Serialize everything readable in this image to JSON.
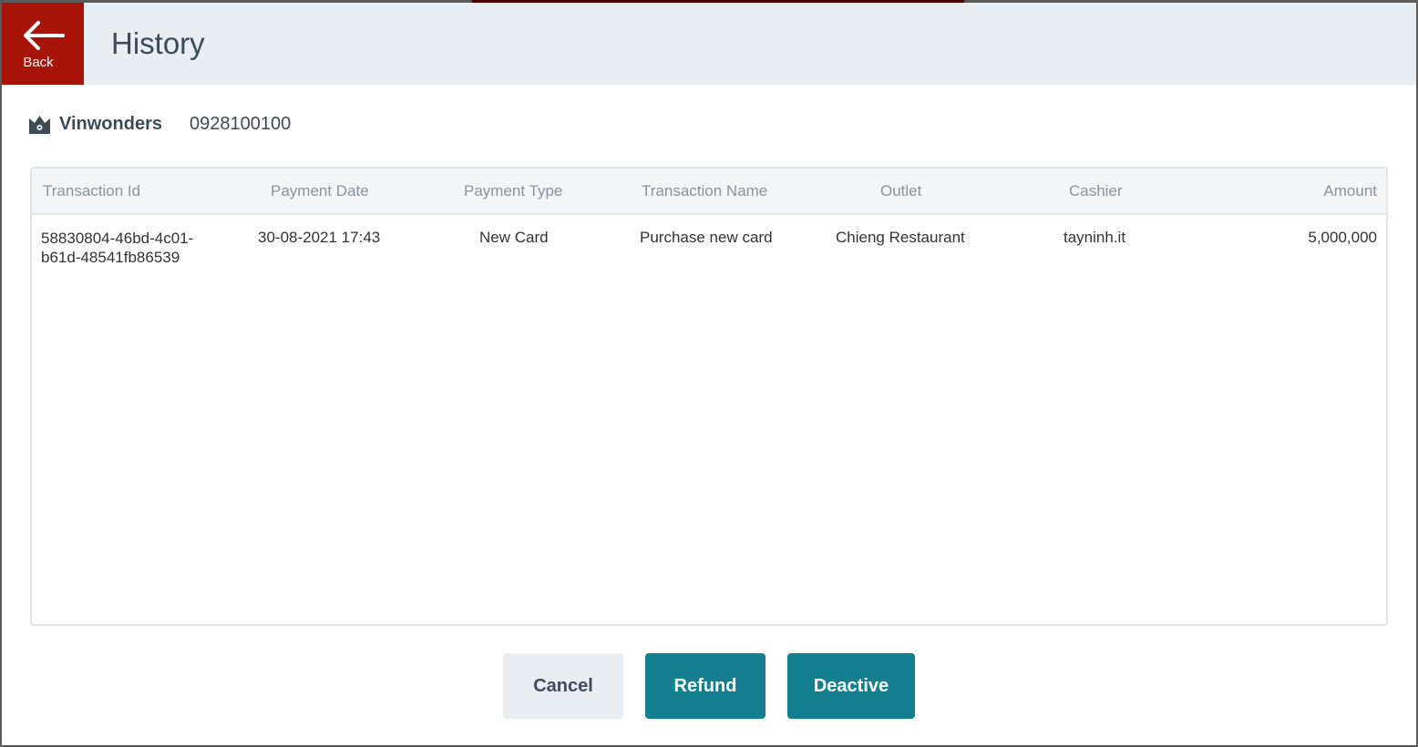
{
  "header": {
    "back_label": "Back",
    "title": "History"
  },
  "account": {
    "name": "Vinwonders",
    "phone": "0928100100"
  },
  "table": {
    "columns": [
      "Transaction Id",
      "Payment Date",
      "Payment Type",
      "Transaction Name",
      "Outlet",
      "Cashier",
      "Amount"
    ],
    "rows": [
      {
        "id_line1": "58830804-46bd-4c01-",
        "id_line2": "b61d-48541fb86539",
        "date": "30-08-2021 17:43",
        "type": "New Card",
        "name": "Purchase new card",
        "outlet": "Chieng Restaurant",
        "cashier": "tayninh.it",
        "amount": "5,000,000"
      }
    ]
  },
  "buttons": {
    "cancel": "Cancel",
    "refund": "Refund",
    "deactive": "Deactive"
  },
  "colors": {
    "back": "#a81408",
    "primary": "#137f8f"
  }
}
